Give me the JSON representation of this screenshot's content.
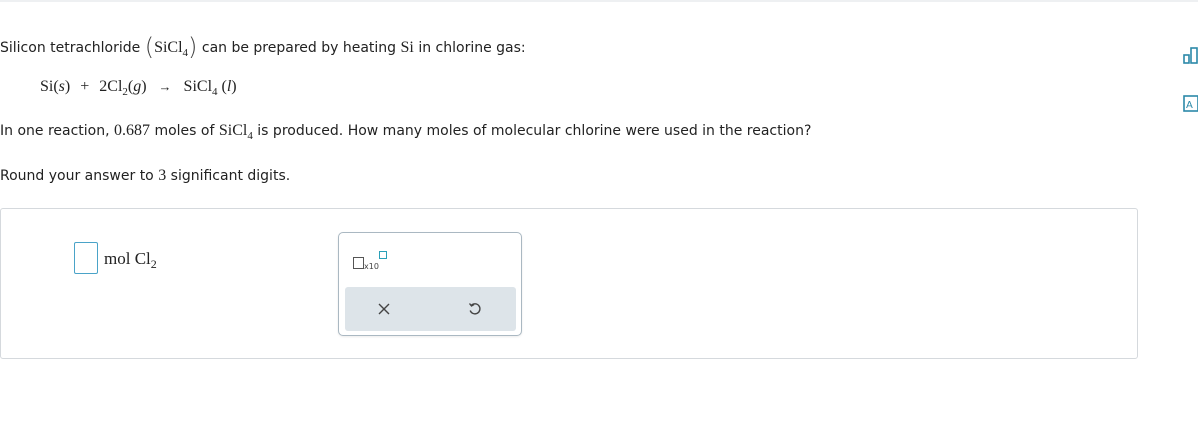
{
  "question": {
    "intro_pre": "Silicon tetrachloride",
    "sicl4_formula": "SiCl",
    "sicl4_subscript": "4",
    "intro_post": "can be prepared by heating",
    "si_symbol": "Si",
    "intro_end": "in chlorine gas:",
    "reaction": {
      "reactant1": "Si",
      "reactant1_state": "s",
      "plus": "+",
      "coef": "2",
      "reactant2": "Cl",
      "reactant2_subscript": "2",
      "reactant2_state": "g",
      "arrow": "→",
      "product": "SiCl",
      "product_subscript": "4",
      "product_state": "l"
    },
    "line2_pre": "In one reaction,",
    "moles_value": "0.687",
    "line2_mid": "moles of",
    "line2_post": "is produced. How many moles of molecular chlorine were used in the reaction?",
    "rounding_pre": "Round your answer to",
    "sig_figs": "3",
    "rounding_post": "significant digits."
  },
  "answer": {
    "value": "",
    "unit_text": "mol Cl",
    "unit_subscript": "2"
  },
  "palette": {
    "x10_label": "x10",
    "x10_icon": "scientific-notation-icon",
    "clear_icon": "close-icon",
    "undo_icon": "undo-icon"
  },
  "side_tools": {
    "icons": [
      "bar-chart-icon",
      "periodic-table-icon"
    ]
  },
  "colors": {
    "accent": "#2b89a8",
    "input_border": "#4aa3c8",
    "palette_bar": "#dde4e9"
  }
}
